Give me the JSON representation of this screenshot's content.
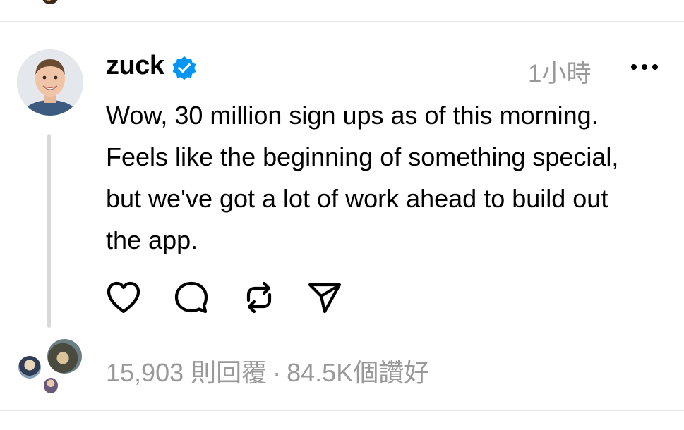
{
  "post": {
    "username": "zuck",
    "verified": true,
    "timestamp": "1小時",
    "text_lines": [
      "Wow, 30 million sign ups as of this morning.",
      "Feels like the beginning of something special,",
      "but we've got a lot of work ahead to build out",
      "the app."
    ],
    "replies_label": "15,903 則回覆",
    "separator": "·",
    "likes_label": "84.5K個讚好"
  },
  "icons": {
    "verified": "verified-badge-icon",
    "more": "more-horizontal-icon",
    "like": "heart-icon",
    "comment": "comment-bubble-icon",
    "repost": "repost-icon",
    "share": "send-icon"
  },
  "colors": {
    "verified_blue": "#0095f6",
    "secondary_text": "#999999",
    "divider": "#e6e6e6",
    "thread_line": "#d9d9d9"
  }
}
